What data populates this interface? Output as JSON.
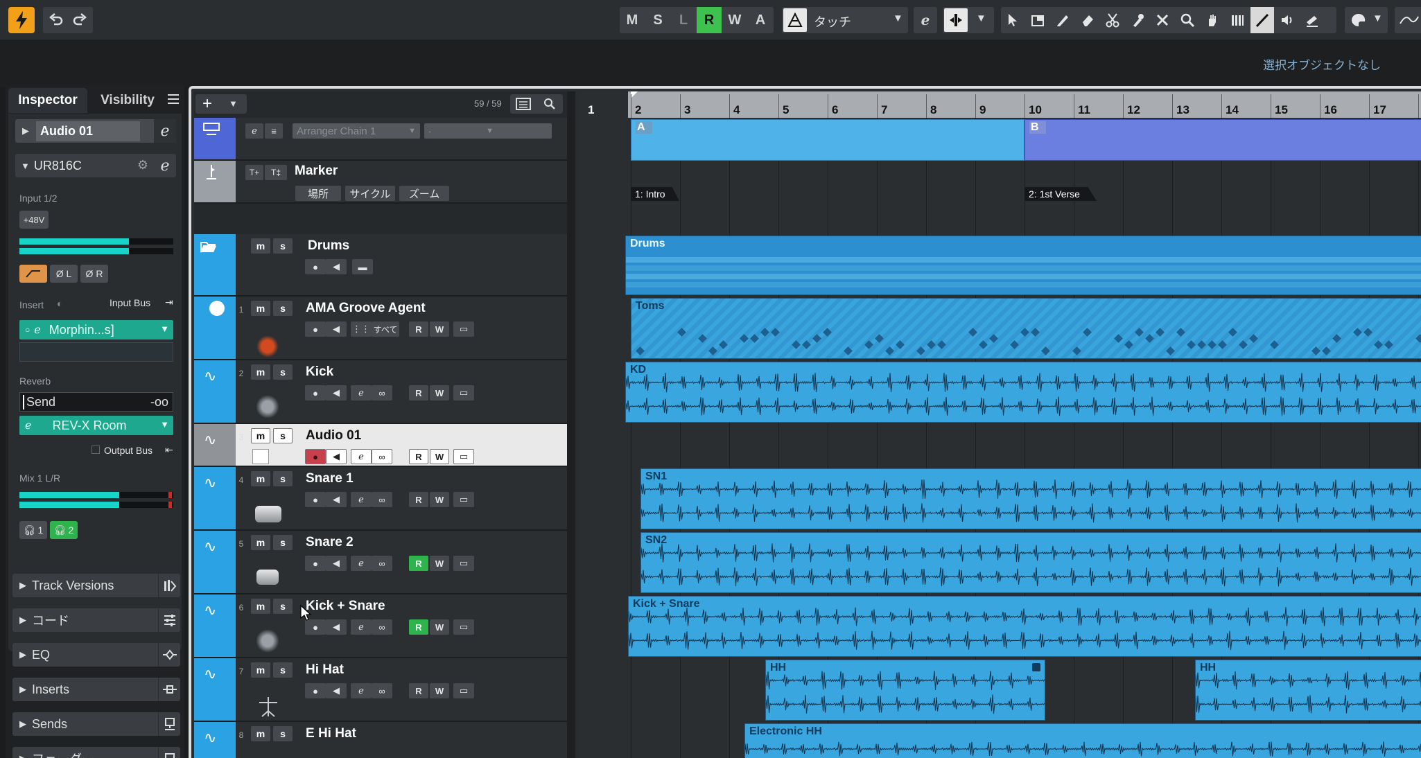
{
  "toolbar": {
    "m": "M",
    "s": "S",
    "l": "L",
    "r": "R",
    "w": "W",
    "a": "A",
    "automation_mode": "タッチ",
    "selection_info": "選択オブジェクトなし"
  },
  "inspector": {
    "tab_inspector": "Inspector",
    "tab_visibility": "Visibility",
    "track_name": "Audio 01",
    "device": "UR816C",
    "input": "Input 1/2",
    "phantom": "+48V",
    "phase_l": "Ø L",
    "phase_r": "Ø R",
    "insert_label": "Insert",
    "input_bus": "Input Bus",
    "insert_slot": "Morphin...s]",
    "reverb_label": "Reverb",
    "send_label": "Send",
    "send_value": "-oo",
    "reverb_slot": "REV-X Room",
    "output_bus": "Output Bus",
    "mix_label": "Mix 1 L/R",
    "cue1": "1",
    "cue2": "2",
    "input_meter_level": 0.71,
    "output_meter_level": 0.65,
    "folds": [
      "Track Versions",
      "コード",
      "EQ",
      "Inserts",
      "Sends",
      "フェーダー"
    ]
  },
  "tracklist": {
    "count": "59 / 59",
    "arranger_chain": "Arranger Chain 1",
    "arranger_dash": "-",
    "marker_name": "Marker",
    "marker_btns": [
      "場所",
      "サイクル",
      "ズーム"
    ],
    "all_label": "すべて",
    "tracks": [
      {
        "num": "",
        "name": "Drums"
      },
      {
        "num": "1",
        "name": "AMA Groove Agent"
      },
      {
        "num": "2",
        "name": "Kick"
      },
      {
        "num": "3",
        "name": "Audio 01"
      },
      {
        "num": "4",
        "name": "Snare 1"
      },
      {
        "num": "5",
        "name": "Snare 2"
      },
      {
        "num": "6",
        "name": "Kick + Snare"
      },
      {
        "num": "7",
        "name": "Hi Hat"
      },
      {
        "num": "8",
        "name": "E Hi Hat"
      }
    ]
  },
  "ruler": {
    "bars": [
      "1",
      "2",
      "3",
      "4",
      "5",
      "6",
      "7",
      "8",
      "9",
      "10",
      "11",
      "12",
      "13",
      "14",
      "15",
      "16",
      "17"
    ]
  },
  "events": {
    "arranger_a": "A",
    "arranger_b": "B",
    "marker1": "1: Intro",
    "marker2": "2: 1st Verse",
    "drums": "Drums",
    "toms": "Toms",
    "kd": "KD",
    "sn1": "SN1",
    "sn2": "SN2",
    "kick_snare": "Kick + Snare",
    "hh1": "HH",
    "hh2": "HH",
    "ehh": "Electronic HH"
  }
}
